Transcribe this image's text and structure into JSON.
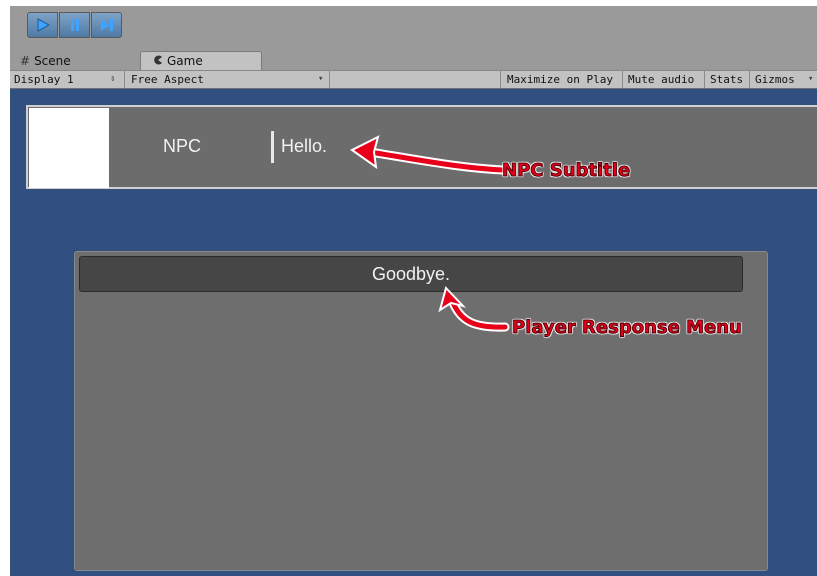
{
  "controls": {
    "play": "play-icon",
    "pause": "pause-icon",
    "step": "step-icon",
    "active_color": "#4f79a4"
  },
  "tabs": {
    "scene": {
      "label": "Scene",
      "icon": "grid-icon"
    },
    "game": {
      "label": "Game",
      "icon": "pacman-icon"
    }
  },
  "toolbar": {
    "display": "Display 1",
    "aspect": "Free Aspect",
    "maximize": "Maximize on Play",
    "mute": "Mute audio",
    "stats": "Stats",
    "gizmos": "Gizmos"
  },
  "game": {
    "background_color": "#314f80",
    "npc_name": "NPC",
    "npc_line": "Hello.",
    "response": "Goodbye."
  },
  "annotations": {
    "npc_subtitle": "NPC Subtitle",
    "player_response_menu": "Player Response Menu",
    "color": "#e8001a"
  }
}
